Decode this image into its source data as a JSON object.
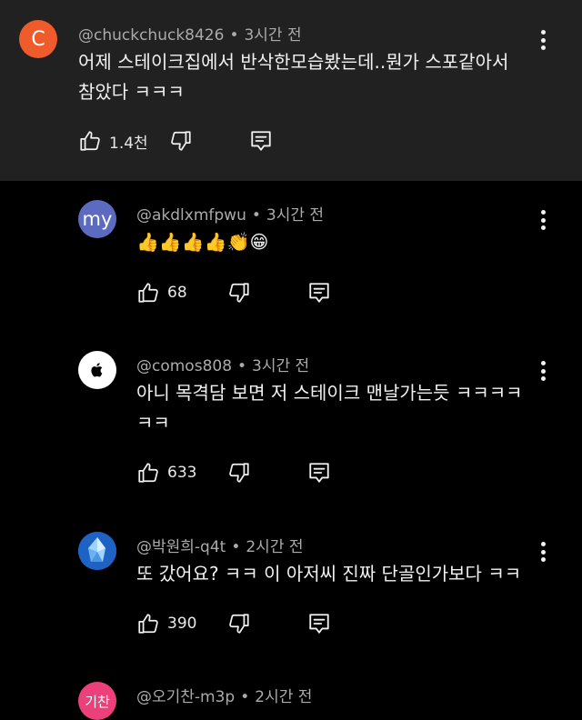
{
  "comments": [
    {
      "avatar_text": "C",
      "avatar_color": "#ef5b2a",
      "username": "@chuckchuck8426",
      "time": "3시간 전",
      "text_line1": "어제 스테이크집에서 반삭한모습봤는데..뭔가 스포같아서",
      "text_line2": "참았다 ㅋㅋㅋ",
      "likes": "1.4천"
    },
    {
      "avatar_text": "my",
      "avatar_color": "#5c6bc0",
      "username": "@akdlxmfpwu",
      "time": "3시간 전",
      "text_line1": "👍👍👍👍👏😁",
      "likes": "68"
    },
    {
      "avatar_text": "",
      "avatar_color": "#ffffff",
      "username": "@comos808",
      "time": "3시간 전",
      "text_line1": "아니 목격담 보면 저 스테이크 맨날가는듯 ㅋㅋㅋㅋ",
      "text_line2": "ㅋㅋ",
      "likes": "633"
    },
    {
      "avatar_text": "",
      "avatar_color": "#1565c0",
      "username": "@박원희-q4t",
      "time": "2시간 전",
      "text_line1": "또 갔어요? ㅋㅋ 이 아저씨 진짜 단골인가보다 ㅋㅋ",
      "likes": "390"
    },
    {
      "avatar_text": "기찬",
      "avatar_color": "#ec407a",
      "username": "@오기찬-m3p",
      "time": "2시간 전"
    }
  ],
  "icons": {
    "like": "thumbs-up-icon",
    "dislike": "thumbs-down-icon",
    "reply": "reply-icon",
    "menu": "more-vert-icon"
  }
}
